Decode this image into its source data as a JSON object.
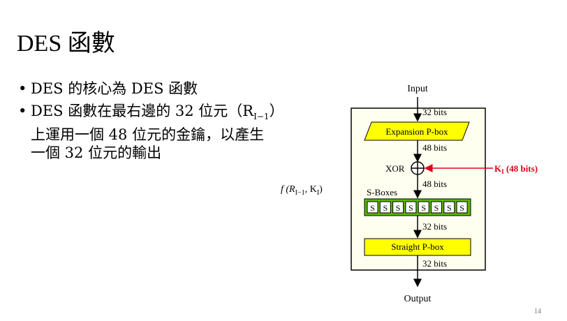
{
  "slide": {
    "title": "DES 函數",
    "page_number": "14"
  },
  "bullets": [
    "DES 的核心為 DES 函數",
    "DES 函數在最右邊的 32 位元（R",
    "I−1",
    "）",
    "上運用一個 48 位元的金鑰，以產生",
    "一個 32 位元的輸出"
  ],
  "diagram": {
    "input_label": "Input",
    "output_label": "Output",
    "function_label_main": "f (R",
    "function_label_sub1": "I−1",
    "function_label_mid": ", K",
    "function_label_sub2": "I",
    "function_label_end": ")",
    "expansion_label": "Expansion P-box",
    "xor_label": "XOR",
    "key_label": "K",
    "key_sub": "I",
    "key_bits": " (48 bits)",
    "sboxes_label": "S-Boxes",
    "sbox_letter": "S",
    "straight_label": "Straight P-box",
    "bits_32a": "32 bits",
    "bits_48a": "48 bits",
    "bits_48b": "48 bits",
    "bits_32b": "32 bits",
    "bits_32c": "32 bits",
    "colors": {
      "box_yellow": "#ffff00",
      "sbox_green": "#5cb800",
      "frame_bg": "#fffff0",
      "key_red": "#e0001a"
    }
  }
}
